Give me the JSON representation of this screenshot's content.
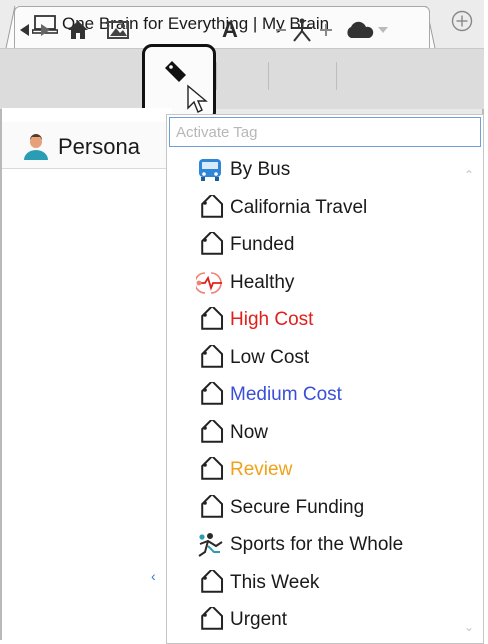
{
  "tab": {
    "title": "One Brain for Everything | My Brain",
    "icon": "laptop-icon",
    "new_tab_icon": "plus-circle-icon"
  },
  "toolbar": {
    "icons": [
      "back-forward-icon",
      "home-icon",
      "image-icon",
      "tag-icon",
      "font-size-icon",
      "minus-icon",
      "layout-icon",
      "plus-icon",
      "cloud-icon",
      "cloud-dropdown-icon"
    ],
    "font_label": "A"
  },
  "left_pane": {
    "header_label": "Persona",
    "icon": "person-icon"
  },
  "tag_dropdown": {
    "placeholder": "Activate Tag",
    "items": [
      {
        "label": "By Bus",
        "icon": "bus-icon",
        "color": "#1a1a1a"
      },
      {
        "label": "California Travel",
        "icon": "tag-icon",
        "color": "#1a1a1a"
      },
      {
        "label": "Funded",
        "icon": "tag-icon",
        "color": "#1a1a1a"
      },
      {
        "label": "Healthy",
        "icon": "heartbeat-icon",
        "color": "#1a1a1a"
      },
      {
        "label": "High Cost",
        "icon": "tag-icon",
        "color": "#e0201c"
      },
      {
        "label": "Low Cost",
        "icon": "tag-icon",
        "color": "#1a1a1a"
      },
      {
        "label": "Medium Cost",
        "icon": "tag-icon",
        "color": "#3a4fd8"
      },
      {
        "label": "Now",
        "icon": "tag-icon",
        "color": "#1a1a1a"
      },
      {
        "label": "Review",
        "icon": "tag-icon",
        "color": "#f0a11a"
      },
      {
        "label": "Secure Funding",
        "icon": "tag-icon",
        "color": "#1a1a1a"
      },
      {
        "label": "Sports for the Whole",
        "icon": "sports-icon",
        "color": "#1a1a1a"
      },
      {
        "label": "This Week",
        "icon": "tag-icon",
        "color": "#1a1a1a"
      },
      {
        "label": "Urgent",
        "icon": "tag-icon",
        "color": "#1a1a1a"
      }
    ]
  }
}
